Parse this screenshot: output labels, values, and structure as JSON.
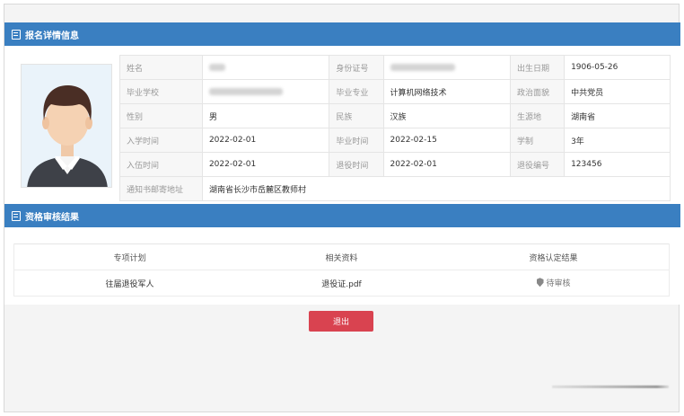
{
  "detail_section": {
    "title": "报名详情信息",
    "rows": [
      [
        {
          "label": "姓名",
          "value": "",
          "blurred": true,
          "blur_width": 18
        },
        {
          "label": "身份证号",
          "value": "",
          "blurred": true,
          "blur_width": 72
        },
        {
          "label": "出生日期",
          "value": "1906-05-26"
        }
      ],
      [
        {
          "label": "毕业学校",
          "value": "",
          "blurred": true,
          "blur_width": 82
        },
        {
          "label": "毕业专业",
          "value": "计算机网络技术"
        },
        {
          "label": "政治面貌",
          "value": "中共党员"
        }
      ],
      [
        {
          "label": "性别",
          "value": "男"
        },
        {
          "label": "民族",
          "value": "汉族"
        },
        {
          "label": "生源地",
          "value": "湖南省"
        }
      ],
      [
        {
          "label": "入学时间",
          "value": "2022-02-01"
        },
        {
          "label": "毕业时间",
          "value": "2022-02-15"
        },
        {
          "label": "学制",
          "value": "3年"
        }
      ],
      [
        {
          "label": "入伍时间",
          "value": "2022-02-01"
        },
        {
          "label": "退役时间",
          "value": "2022-02-01"
        },
        {
          "label": "退役编号",
          "value": "123456"
        }
      ]
    ],
    "address": {
      "label": "通知书邮寄地址",
      "value": "湖南省长沙市岳麓区教师村"
    }
  },
  "review_section": {
    "title": "资格审核结果",
    "columns": [
      "专项计划",
      "相关资料",
      "资格认定结果"
    ],
    "rows": [
      {
        "plan": "往届退役军人",
        "document": "退役证.pdf",
        "result": "待审核"
      }
    ]
  },
  "exit_button": {
    "label": "退出"
  },
  "colors": {
    "header_blue": "#3a7fc1",
    "exit_red": "#d94350"
  }
}
